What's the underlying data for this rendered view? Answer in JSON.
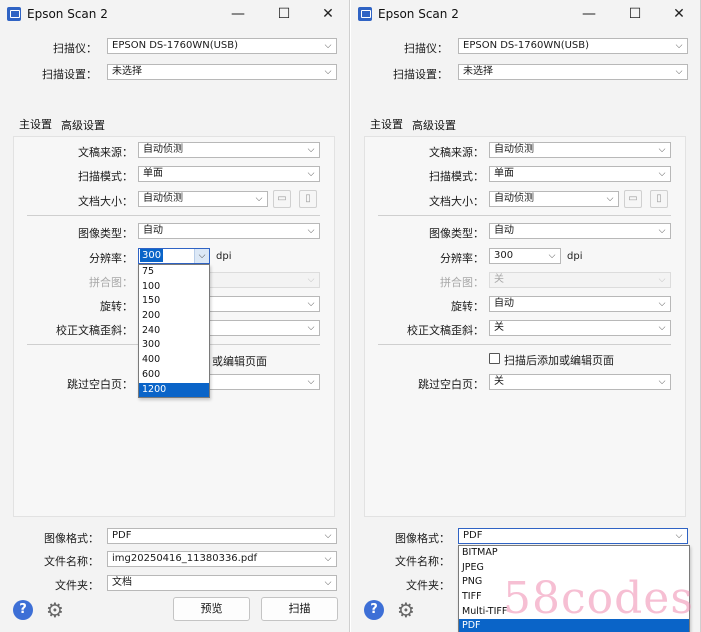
{
  "left": {
    "title": "Epson Scan 2",
    "window_controls": {
      "min": "—",
      "max": "☐",
      "close": "✕"
    },
    "scanner_label": "扫描仪：",
    "scanner_value": "EPSON DS-1760WN(USB)",
    "scan_settings_label": "扫描设置：",
    "scan_settings_value": "未选择",
    "tab_main": "主设置",
    "tab_advanced": "高级设置",
    "source_label": "文稿来源：",
    "source_value": "自动侦测",
    "mode_label": "扫描模式：",
    "mode_value": "单面",
    "doc_size_label": "文档大小：",
    "doc_size_value": "自动侦测",
    "image_type_label": "图像类型：",
    "image_type_value": "自动",
    "resolution_label": "分辨率：",
    "resolution_value": "300",
    "dpi_unit": "dpi",
    "stitch_label": "拼合图：",
    "rotate_label": "旋转：",
    "deskew_label": "校正文稿歪斜：",
    "add_edit_partial": "或编辑页面",
    "skip_blank_label": "跳过空白页：",
    "resolution_options": [
      "75",
      "100",
      "150",
      "200",
      "240",
      "300",
      "400",
      "600",
      "1200"
    ],
    "resolution_highlight": "1200",
    "image_format_label": "图像格式：",
    "image_format_value": "PDF",
    "filename_label": "文件名称：",
    "filename_value": "img20250416_11380336.pdf",
    "folder_label": "文件夹：",
    "folder_value": "文档",
    "preview_button": "预览",
    "scan_button": "扫描",
    "help_glyph": "?",
    "gear_glyph": "⚙"
  },
  "right": {
    "title": "Epson Scan 2",
    "window_controls": {
      "min": "—",
      "max": "☐",
      "close": "✕"
    },
    "scanner_label": "扫描仪：",
    "scanner_value": "EPSON DS-1760WN(USB)",
    "scan_settings_label": "扫描设置：",
    "scan_settings_value": "未选择",
    "tab_main": "主设置",
    "tab_advanced": "高级设置",
    "source_label": "文稿来源：",
    "source_value": "自动侦测",
    "mode_label": "扫描模式：",
    "mode_value": "单面",
    "doc_size_label": "文档大小：",
    "doc_size_value": "自动侦测",
    "image_type_label": "图像类型：",
    "image_type_value": "自动",
    "resolution_label": "分辨率：",
    "resolution_value": "300",
    "dpi_unit": "dpi",
    "stitch_label": "拼合图：",
    "stitch_value": "关",
    "rotate_label": "旋转：",
    "rotate_value": "自动",
    "deskew_label": "校正文稿歪斜：",
    "deskew_value": "关",
    "add_edit_label": "扫描后添加或编辑页面",
    "skip_blank_label": "跳过空白页：",
    "skip_blank_value": "关",
    "image_format_label": "图像格式：",
    "image_format_value": "PDF",
    "format_options": [
      "BITMAP",
      "JPEG",
      "PNG",
      "TIFF",
      "Multi-TIFF",
      "PDF"
    ],
    "filename_label": "文件名称：",
    "folder_label": "文件夹：",
    "help_glyph": "?",
    "gear_glyph": "⚙"
  },
  "watermark": "58codes"
}
